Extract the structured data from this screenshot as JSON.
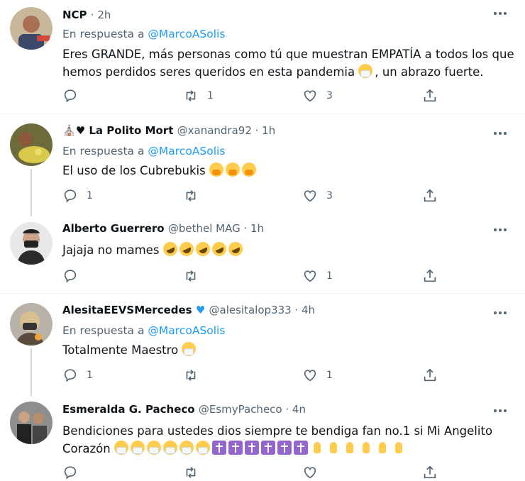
{
  "tweets": [
    {
      "name": "NCP",
      "handle": "· 2h",
      "reply_prefix": "En respuesta a",
      "reply_handle": "@MarcoASolis",
      "text": "Eres GRANDE, más personas como tú que muestran EMPATÍA a todos los que hemos perdidos seres queridos en esta pandemia",
      "text_tail": ", un abrazo fuerte.",
      "replies": "",
      "retweets": "1",
      "likes": "3"
    },
    {
      "name": "La Polito",
      "name_tail": "Mort",
      "handle": "@xanandra92 · 1h",
      "reply_prefix": "En respuesta a",
      "reply_handle": "@MarcoASolis",
      "text": "El uso de los Cubrebukis",
      "replies": "1",
      "retweets": "",
      "likes": "3"
    },
    {
      "name": "Alberto Guerrero",
      "handle": "@bethel MAG · 1h",
      "text": "Jajaja no mames",
      "replies": "",
      "retweets": "",
      "likes": "1"
    },
    {
      "name": "AlesitaEEVSMercedes",
      "handle": "@alesitalop333 · 4h",
      "reply_prefix": "En respuesta a",
      "reply_handle": "@MarcoASolis",
      "text": "Totalmente Maestro",
      "replies": "1",
      "retweets": "",
      "likes": "1"
    },
    {
      "name": "Esmeralda G. Pacheco",
      "handle": "@EsmyPacheco · 4n",
      "text": "Bendiciones para ustedes dios siempre te bendiga fan no.1 si Mi Angelito Corazón"
    }
  ],
  "icons": {
    "reply": "reply-icon",
    "retweet": "retweet-icon",
    "like": "heart-icon",
    "share": "share-icon",
    "more": "more-icon"
  },
  "colors": {
    "link": "#1d9bf0",
    "secondary": "#536471",
    "thread_line": "#cfd9de"
  }
}
